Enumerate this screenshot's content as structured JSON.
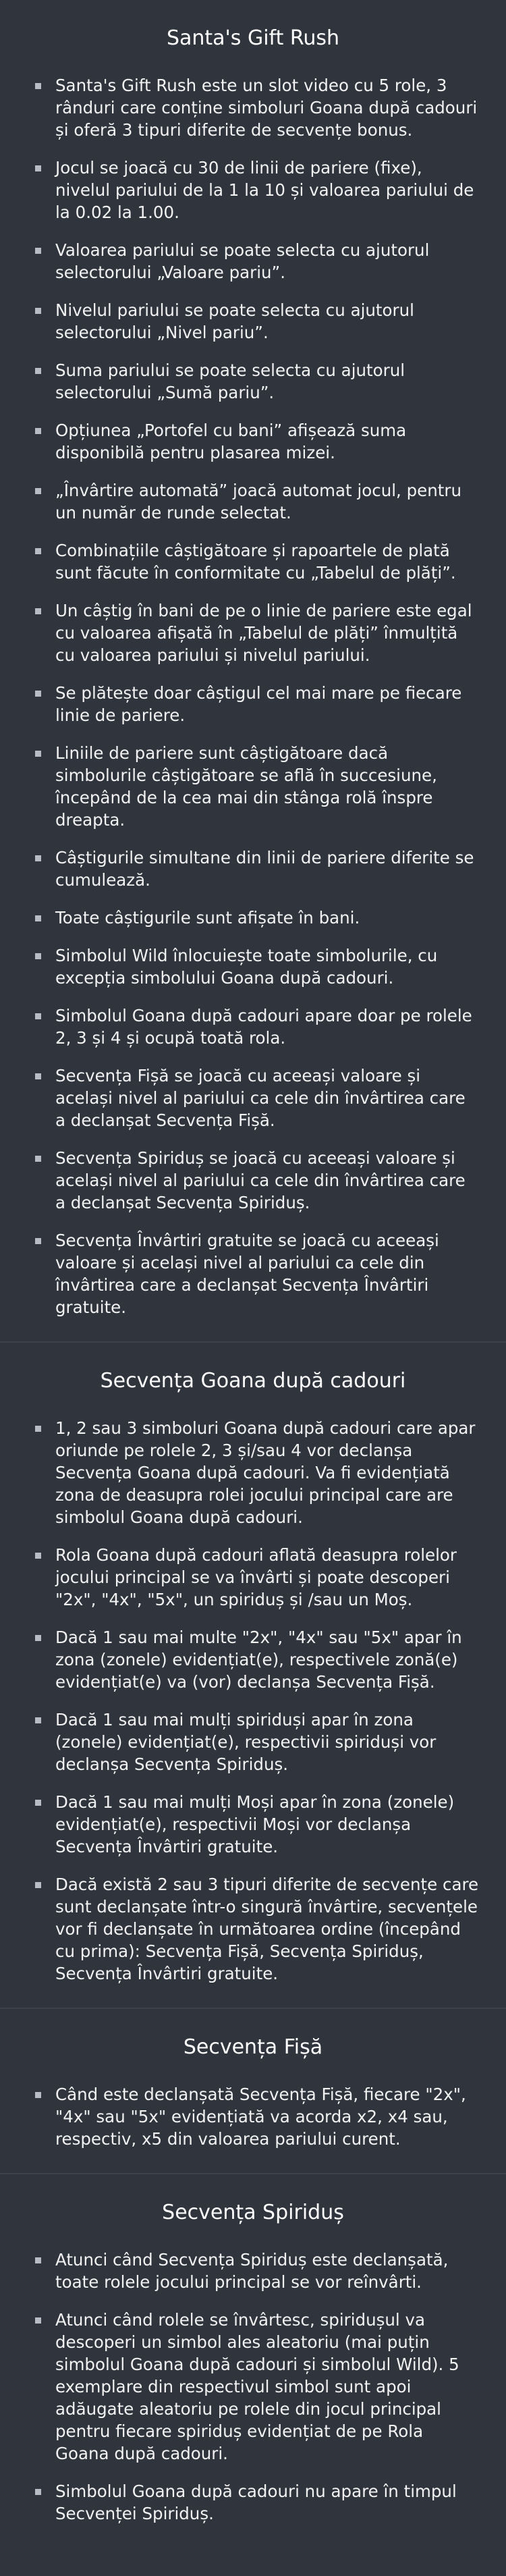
{
  "sections": [
    {
      "title": "Santa's Gift Rush",
      "items": [
        "Santa's Gift Rush este un slot video cu 5 role, 3 rânduri care conține simboluri Goana după cadouri și oferă 3 tipuri diferite de secvențe bonus.",
        "Jocul se joacă cu 30 de linii de pariere (fixe), nivelul pariului de la 1 la 10 și valoarea pariului de la 0.02 la 1.00.",
        "Valoarea pariului se poate selecta cu ajutorul selectorului „Valoare pariu”.",
        "Nivelul pariului se poate selecta cu ajutorul selectorului „Nivel pariu”.",
        "Suma pariului se poate selecta cu ajutorul selectorului „Sumă pariu”.",
        "Opțiunea „Portofel cu bani” afișează suma disponibilă pentru plasarea mizei.",
        "„Învârtire automată” joacă automat jocul, pentru un număr de runde selectat.",
        "Combinațiile câștigătoare și rapoartele de plată sunt făcute în conformitate cu „Tabelul de plăți”.",
        "Un câștig în bani de pe o linie de pariere este egal cu valoarea afișată în „Tabelul de plăți” înmulțită cu valoarea pariului și nivelul pariului.",
        "Se plătește doar câștigul cel mai mare pe fiecare linie de pariere.",
        "Liniile de pariere sunt câștigătoare dacă simbolurile câștigătoare se află în succesiune, începând de la cea mai din stânga rolă înspre dreapta.",
        "Câștigurile simultane din linii de pariere diferite se cumulează.",
        "Toate câștigurile sunt afișate în bani.",
        "Simbolul Wild înlocuiește toate simbolurile, cu excepția simbolului Goana după cadouri.",
        "Simbolul Goana după cadouri apare doar pe rolele 2, 3 și 4 și ocupă toată rola.",
        "Secvența Fișă se joacă cu aceeași valoare și același nivel al pariului ca cele din învârtirea care a declanșat Secvența Fișă.",
        "Secvența Spiriduș se joacă cu aceeași valoare și același nivel al pariului ca cele din învârtirea care a declanșat Secvența Spiriduș.",
        "Secvența Învârtiri gratuite se joacă cu aceeași valoare și același nivel al pariului ca cele din învârtirea care a declanșat Secvența Învârtiri gratuite."
      ]
    },
    {
      "title": "Secvența Goana după cadouri",
      "items": [
        "1, 2 sau 3 simboluri Goana după cadouri care apar oriunde pe rolele 2, 3 și/sau 4 vor declanșa Secvența Goana după cadouri. Va fi evidențiată zona de deasupra rolei jocului principal care are simbolul Goana după cadouri.",
        "Rola Goana după cadouri aflată deasupra rolelor jocului principal se va învârti și poate descoperi \"2x\", \"4x\", \"5x\", un spiriduș și /sau un Moș.",
        "Dacă 1 sau mai multe \"2x\", \"4x\" sau \"5x\" apar în zona (zonele) evidențiat(e), respectivele zonă(e) evidențiat(e) va (vor) declanșa Secvența Fișă.",
        "Dacă 1 sau mai mulți spiriduși apar în zona (zonele) evidențiat(e), respectivii spiriduși vor declanșa Secvența Spiriduș.",
        "Dacă 1 sau mai mulți Moși apar în zona (zonele) evidențiat(e), respectivii Moși vor declanșa Secvența Învârtiri gratuite.",
        "Dacă există 2 sau 3 tipuri diferite de secvențe care sunt declanșate într-o singură învârtire, secvențele vor fi declanșate în următoarea ordine (începând cu prima): Secvența Fișă, Secvența Spiriduș, Secvența Învârtiri gratuite."
      ]
    },
    {
      "title": "Secvența Fișă",
      "items": [
        "Când este declanșată Secvența Fișă, fiecare \"2x\", \"4x\" sau \"5x\" evidențiată va acorda x2, x4 sau, respectiv, x5 din valoarea pariului curent."
      ]
    },
    {
      "title": "Secvența Spiriduș",
      "items": [
        "Atunci când Secvența Spiriduș este declanșată, toate rolele jocului principal se vor reînvârti.",
        "Atunci când rolele se învârtesc, spiridușul va descoperi un simbol ales aleatoriu (mai puțin simbolul Goana după cadouri și simbolul Wild). 5 exemplare din respectivul simbol sunt apoi adăugate aleatoriu pe rolele din jocul principal pentru fiecare spiriduș evidențiat de pe Rola Goana după cadouri.",
        "Simbolul Goana după cadouri nu apare în timpul Secvenței Spiriduș."
      ]
    }
  ]
}
